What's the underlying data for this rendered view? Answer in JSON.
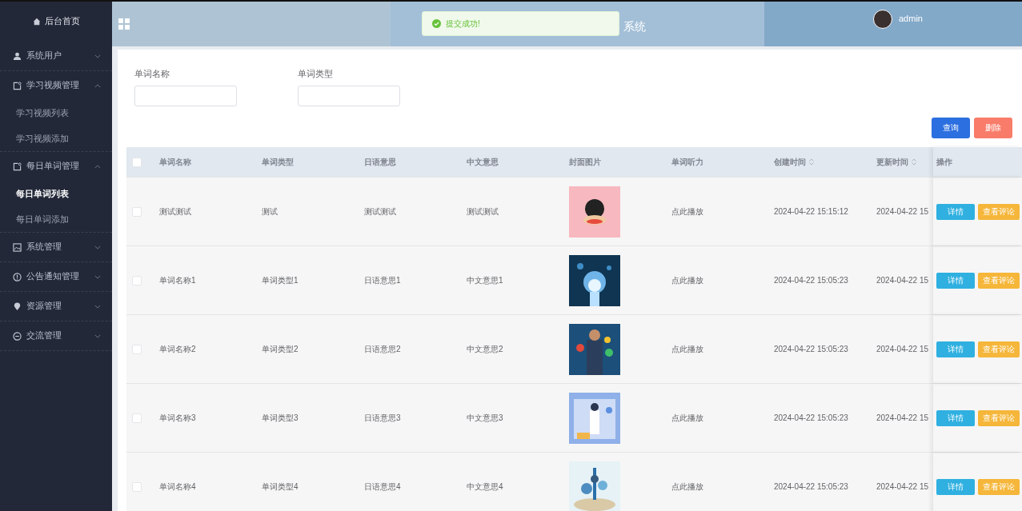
{
  "sidebar": {
    "home": {
      "label": "后台首页"
    },
    "menus": [
      {
        "label": "系统用户",
        "expanded": false
      },
      {
        "label": "学习视频管理",
        "expanded": true,
        "children": [
          {
            "label": "学习视频列表",
            "selected": false
          },
          {
            "label": "学习视频添加",
            "selected": false
          }
        ]
      },
      {
        "label": "每日单词管理",
        "expanded": true,
        "children": [
          {
            "label": "每日单词列表",
            "selected": true
          },
          {
            "label": "每日单词添加",
            "selected": false
          }
        ]
      },
      {
        "label": "系统管理",
        "expanded": false
      },
      {
        "label": "公告通知管理",
        "expanded": false
      },
      {
        "label": "资源管理",
        "expanded": false
      },
      {
        "label": "交流管理",
        "expanded": false
      }
    ]
  },
  "header": {
    "title": "系统",
    "toast": {
      "text": "提交成功!"
    },
    "user": {
      "name": "admin"
    }
  },
  "search": {
    "fields": [
      {
        "label": "单词名称"
      },
      {
        "label": "单词类型"
      }
    ],
    "buttons": [
      {
        "label": "查询",
        "kind": "primary"
      },
      {
        "label": "删除",
        "kind": "danger"
      }
    ]
  },
  "table": {
    "all_checked": false,
    "columns": [
      {
        "label": "单词名称",
        "sortable": false
      },
      {
        "label": "单词类型",
        "sortable": false
      },
      {
        "label": "日语意思",
        "sortable": false
      },
      {
        "label": "中文意思",
        "sortable": false
      },
      {
        "label": "封面图片",
        "sortable": false
      },
      {
        "label": "单词听力",
        "sortable": false
      },
      {
        "label": "创建时间",
        "sortable": true
      },
      {
        "label": "更新时间",
        "sortable": true
      },
      {
        "label": "操作",
        "sortable": false
      }
    ],
    "rows": [
      {
        "checked": false,
        "cells": [
          "测试测试",
          "测试",
          "测试测试",
          "测试测试"
        ],
        "image": {
          "kind": "picture"
        },
        "audio": "点此播放",
        "created": "2024-04-22 15:15:12",
        "updated": "2024-04-22 15",
        "actions": [
          "详情",
          "查看评论"
        ]
      },
      {
        "checked": false,
        "cells": [
          "单词名称1",
          "单词类型1",
          "日语意思1",
          "中文意思1"
        ],
        "image": {
          "kind": "picture"
        },
        "audio": "点此播放",
        "created": "2024-04-22 15:05:23",
        "updated": "2024-04-22 15",
        "actions": [
          "详情",
          "查看评论"
        ]
      },
      {
        "checked": false,
        "cells": [
          "单词名称2",
          "单词类型2",
          "日语意思2",
          "中文意思2"
        ],
        "image": {
          "kind": "picture"
        },
        "audio": "点此播放",
        "created": "2024-04-22 15:05:23",
        "updated": "2024-04-22 15",
        "actions": [
          "详情",
          "查看评论"
        ]
      },
      {
        "checked": false,
        "cells": [
          "单词名称3",
          "单词类型3",
          "日语意思3",
          "中文意思3"
        ],
        "image": {
          "kind": "picture"
        },
        "audio": "点此播放",
        "created": "2024-04-22 15:05:23",
        "updated": "2024-04-22 15",
        "actions": [
          "详情",
          "查看评论"
        ]
      },
      {
        "checked": false,
        "cells": [
          "单词名称4",
          "单词类型4",
          "日语意思4",
          "中文意思4"
        ],
        "image": {
          "kind": "picture"
        },
        "audio": "点此播放",
        "created": "2024-04-22 15:05:23",
        "updated": "2024-04-22 15",
        "actions": [
          "详情",
          "查看评论"
        ]
      }
    ]
  }
}
